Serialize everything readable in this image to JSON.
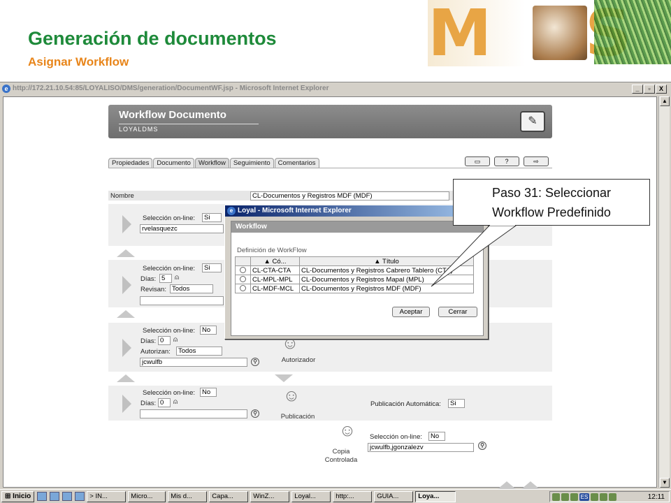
{
  "slide": {
    "title": "Generación de documentos",
    "subtitle": "Asignar Workflow",
    "logo_text": "MAS"
  },
  "browser": {
    "title": "http://172.21.10.54:85/LOYALISO/DMS/generation/DocumentWF.jsp - Microsoft Internet Explorer",
    "buttons": [
      "_",
      "▫",
      "X"
    ]
  },
  "app": {
    "header_title": "Workflow Documento",
    "header_sub": "LOYALDMS",
    "tabs": [
      "Propiedades",
      "Documento",
      "Workflow",
      "Seguimiento",
      "Comentarios"
    ],
    "active_tab": "Workflow",
    "nombre_label": "Nombre",
    "nombre_value": "CL-Documentos y Registros MDF (MDF)",
    "step1": {
      "sel_label": "Selección on-line:",
      "sel_value": "Si",
      "user": "rvelasquezc"
    },
    "step2": {
      "sel_label": "Selección on-line:",
      "sel_value": "Si",
      "dias_label": "Días:",
      "dias_value": "5",
      "revisan_label": "Revisan:",
      "revisan_value": "Todos"
    },
    "step3": {
      "sel_label": "Selección on-line:",
      "sel_value": "No",
      "dias_label": "Días:",
      "dias_value": "0",
      "autorizan_label": "Autorizan:",
      "autorizan_value": "Todos",
      "user": "jcwulfb",
      "role": "Autorizador"
    },
    "step4": {
      "sel_label": "Selección on-line:",
      "sel_value": "No",
      "dias_label": "Días:",
      "dias_value": "0",
      "pub_label": "Publicación Automática:",
      "pub_value": "Si",
      "role": "Publicación"
    },
    "step5": {
      "sel_label": "Selección on-line:",
      "sel_value": "No",
      "users": "jcwulfb,jgonzalezv",
      "role_line1": "Copia",
      "role_line2": "Controlada"
    }
  },
  "dialog": {
    "title": "Loyal - Microsoft Internet Explorer",
    "panel_title": "Workflow",
    "definition_label": "Definición de WorkFlow",
    "col_code": "▲ Có...",
    "col_title": "▲ Título",
    "rows": [
      {
        "code": "CL-CTA-CTA",
        "title": "CL-Documentos y Registros Cabrero Tablero (CTA)"
      },
      {
        "code": "CL-MPL-MPL",
        "title": "CL-Documentos y Registros Mapal (MPL)"
      },
      {
        "code": "CL-MDF-MCL",
        "title": "CL-Documentos y Registros MDF (MDF)"
      }
    ],
    "accept": "Aceptar",
    "cancel": "Cerrar"
  },
  "callout": {
    "line1": "Paso 31: Seleccionar",
    "line2": "Workflow Predefinido"
  },
  "taskbar": {
    "start": "Inicio",
    "tasks": [
      "> IN...",
      "Micro...",
      "Mis d...",
      "Capa...",
      "WinZ...",
      "Loyal...",
      "http:...",
      "GUIA...",
      "Loya..."
    ],
    "active_task": "Loya...",
    "lang": "ES",
    "clock": "12:11"
  }
}
